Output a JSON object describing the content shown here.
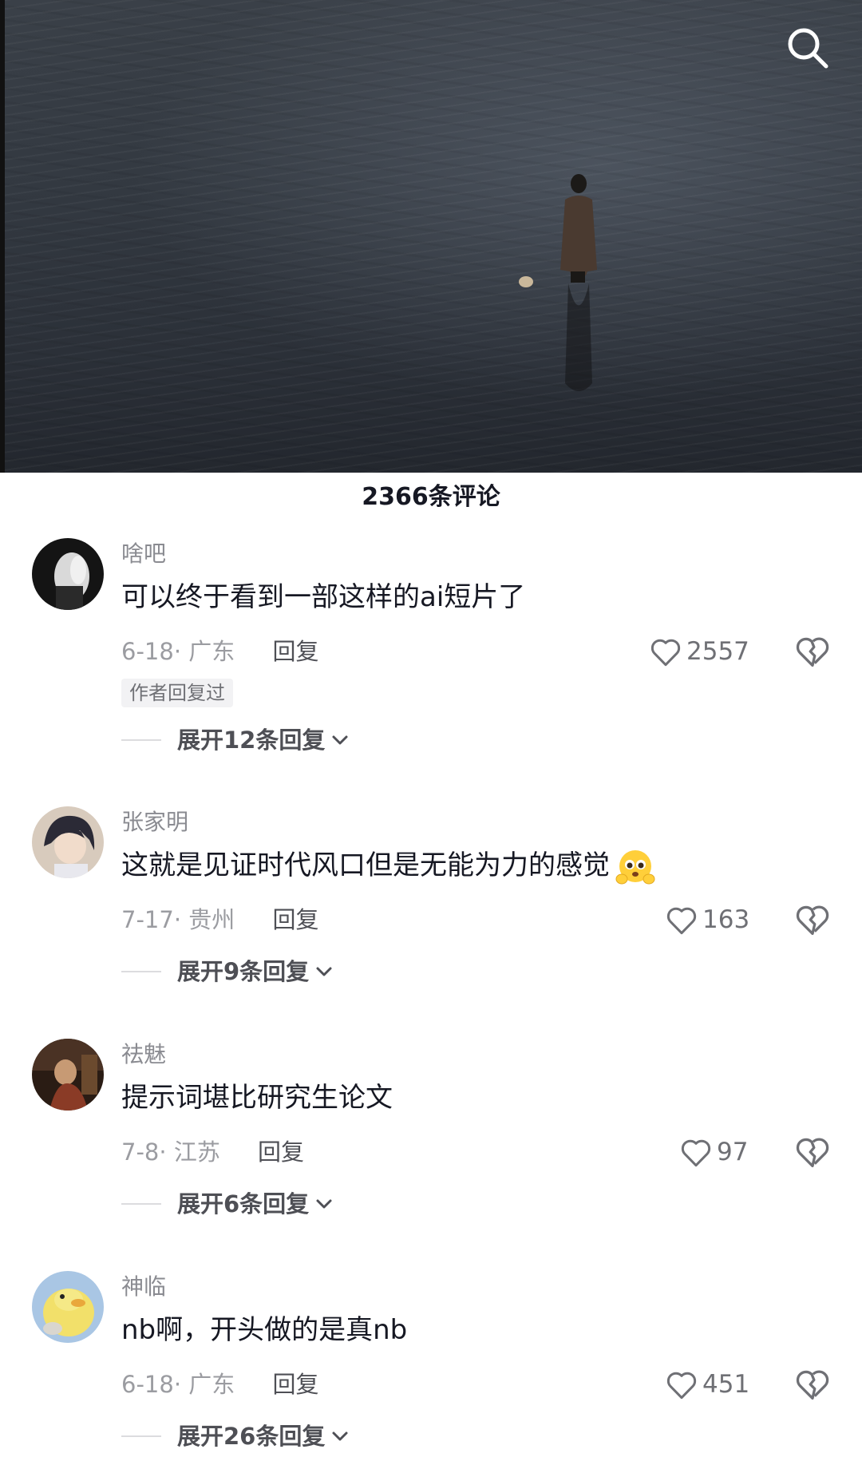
{
  "video": {
    "search_icon": "search-icon"
  },
  "comments_header": {
    "count_label": "2366条评论"
  },
  "comments": [
    {
      "username": "啥吧",
      "text": "可以终于看到一部这样的ai短片了",
      "date": "6-18",
      "location": "广东",
      "reply_label": "回复",
      "likes": "2557",
      "author_replied": "作者回复过",
      "expand_label": "展开12条回复"
    },
    {
      "username": "张家明",
      "text": "这就是见证时代风口但是无能为力的感觉",
      "emoji": "pleading-face-emoji",
      "date": "7-17",
      "location": "贵州",
      "reply_label": "回复",
      "likes": "163",
      "expand_label": "展开9条回复"
    },
    {
      "username": "祛魅",
      "text": "提示词堪比研究生论文",
      "date": "7-8",
      "location": "江苏",
      "reply_label": "回复",
      "likes": "97",
      "expand_label": "展开6条回复"
    },
    {
      "username": "神临",
      "text": "nb啊，开头做的是真nb",
      "date": "6-18",
      "location": "广东",
      "reply_label": "回复",
      "likes": "451",
      "expand_label": "展开26条回复"
    }
  ]
}
